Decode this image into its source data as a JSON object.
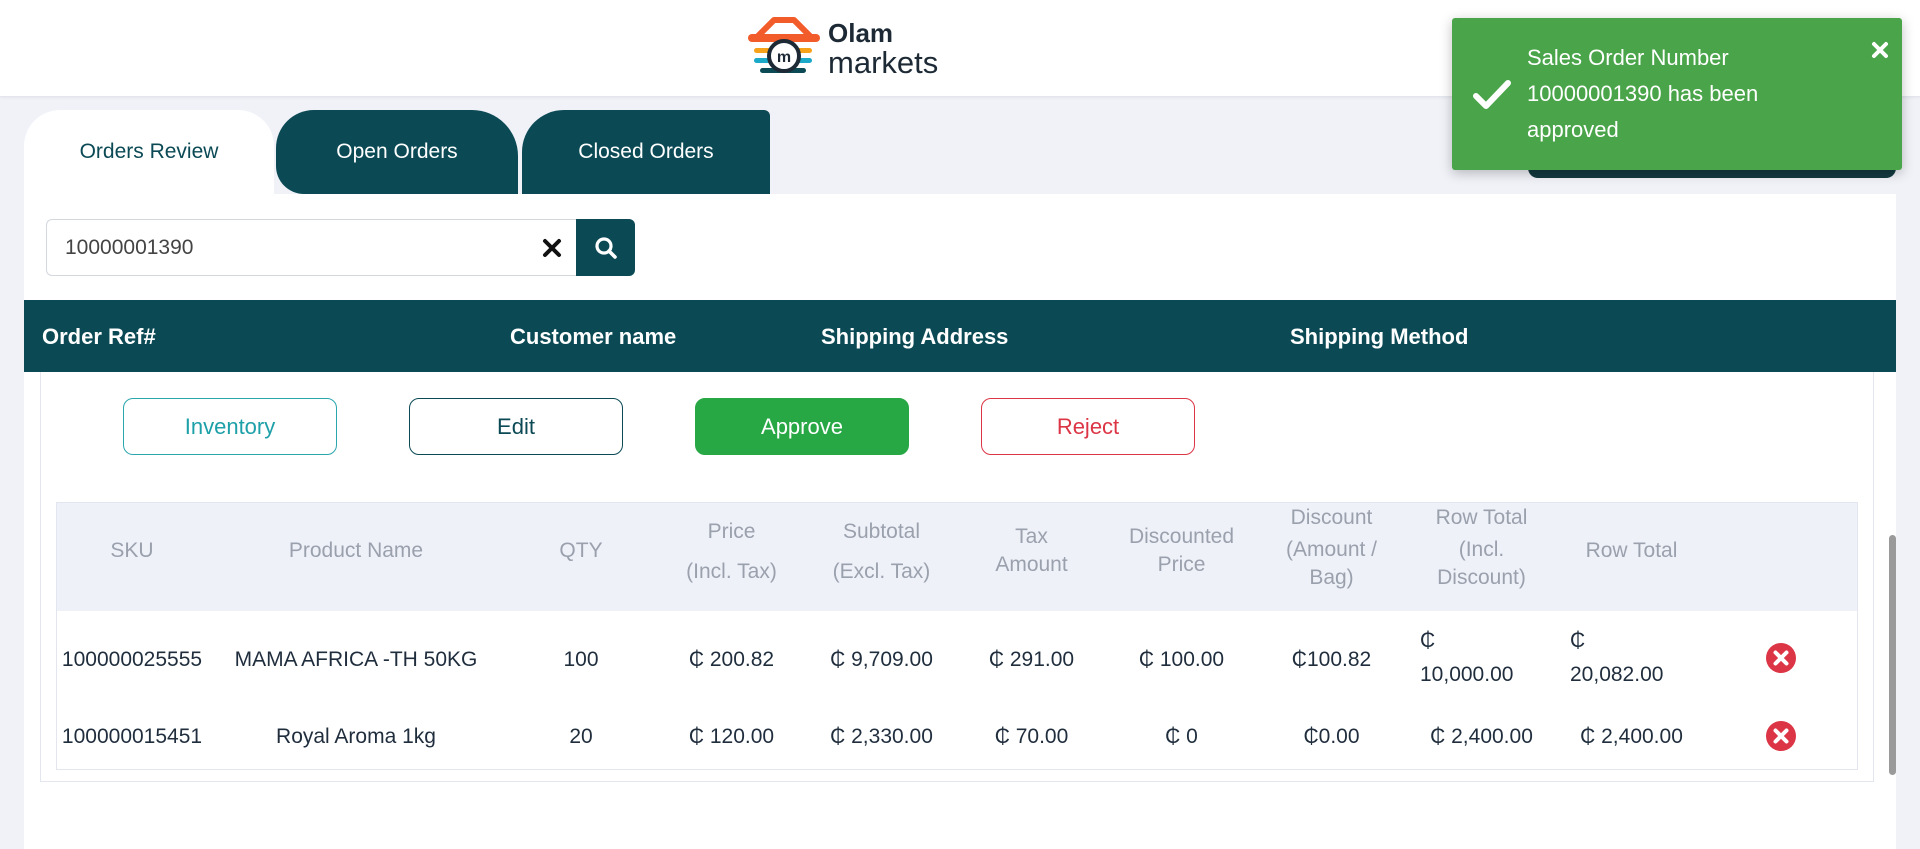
{
  "brand": {
    "name_line1": "Olam",
    "name_line2": "markets"
  },
  "colors": {
    "primary": "#0b4a55",
    "approve": "#28a745",
    "reject": "#dc3545",
    "inventory": "#1ea0a8",
    "toast": "#4aa54a"
  },
  "tabs": [
    {
      "label": "Orders Review",
      "active": true
    },
    {
      "label": "Open Orders",
      "active": false
    },
    {
      "label": "Closed Orders",
      "active": false
    }
  ],
  "search": {
    "value": "10000001390",
    "clear_icon": "close-icon",
    "button_icon": "search-icon"
  },
  "orders_table": {
    "columns": [
      "Order Ref#",
      "Customer name",
      "Shipping Address",
      "Shipping Method"
    ]
  },
  "actions": {
    "inventory": "Inventory",
    "edit": "Edit",
    "approve": "Approve",
    "reject": "Reject"
  },
  "items_table": {
    "headers": {
      "sku": "SKU",
      "product": "Product Name",
      "qty": "QTY",
      "price_1": "Price",
      "price_2": "(Incl. Tax)",
      "subtotal_1": "Subtotal",
      "subtotal_2": "(Excl. Tax)",
      "tax_1": "Tax",
      "tax_2": "Amount",
      "disc_price_1": "Discounted",
      "disc_price_2": "Price",
      "discount_1": "Discount",
      "discount_2": "(Amount /",
      "discount_3": "Bag)",
      "row_total_disc_1": "Row Total",
      "row_total_disc_2": "(Incl.",
      "row_total_disc_3": "Discount)",
      "row_total": "Row Total"
    },
    "rows": [
      {
        "sku": "100000025555",
        "product": "MAMA AFRICA -TH 50KG",
        "qty": "100",
        "price": "₵ 200.82",
        "subtotal": "₵ 9,709.00",
        "tax": "₵ 291.00",
        "discounted_price": "₵ 100.00",
        "discount": "₵100.82",
        "row_total_incl_1": "₵",
        "row_total_incl_2": "10,000.00",
        "row_total_1": "₵",
        "row_total_2": "20,082.00",
        "remove_icon": "remove-icon"
      },
      {
        "sku": "100000015451",
        "product": "Royal Aroma 1kg",
        "qty": "20",
        "price": "₵ 120.00",
        "subtotal": "₵ 2,330.00",
        "tax": "₵ 70.00",
        "discounted_price": "₵ 0",
        "discount": "₵0.00",
        "row_total_incl": "₵ 2,400.00",
        "row_total": "₵ 2,400.00",
        "remove_icon": "remove-icon"
      }
    ]
  },
  "toast": {
    "line1": "Sales Order Number",
    "line2": "10000001390 has been",
    "line3": "approved",
    "icon": "check-icon",
    "close_icon": "close-icon"
  }
}
